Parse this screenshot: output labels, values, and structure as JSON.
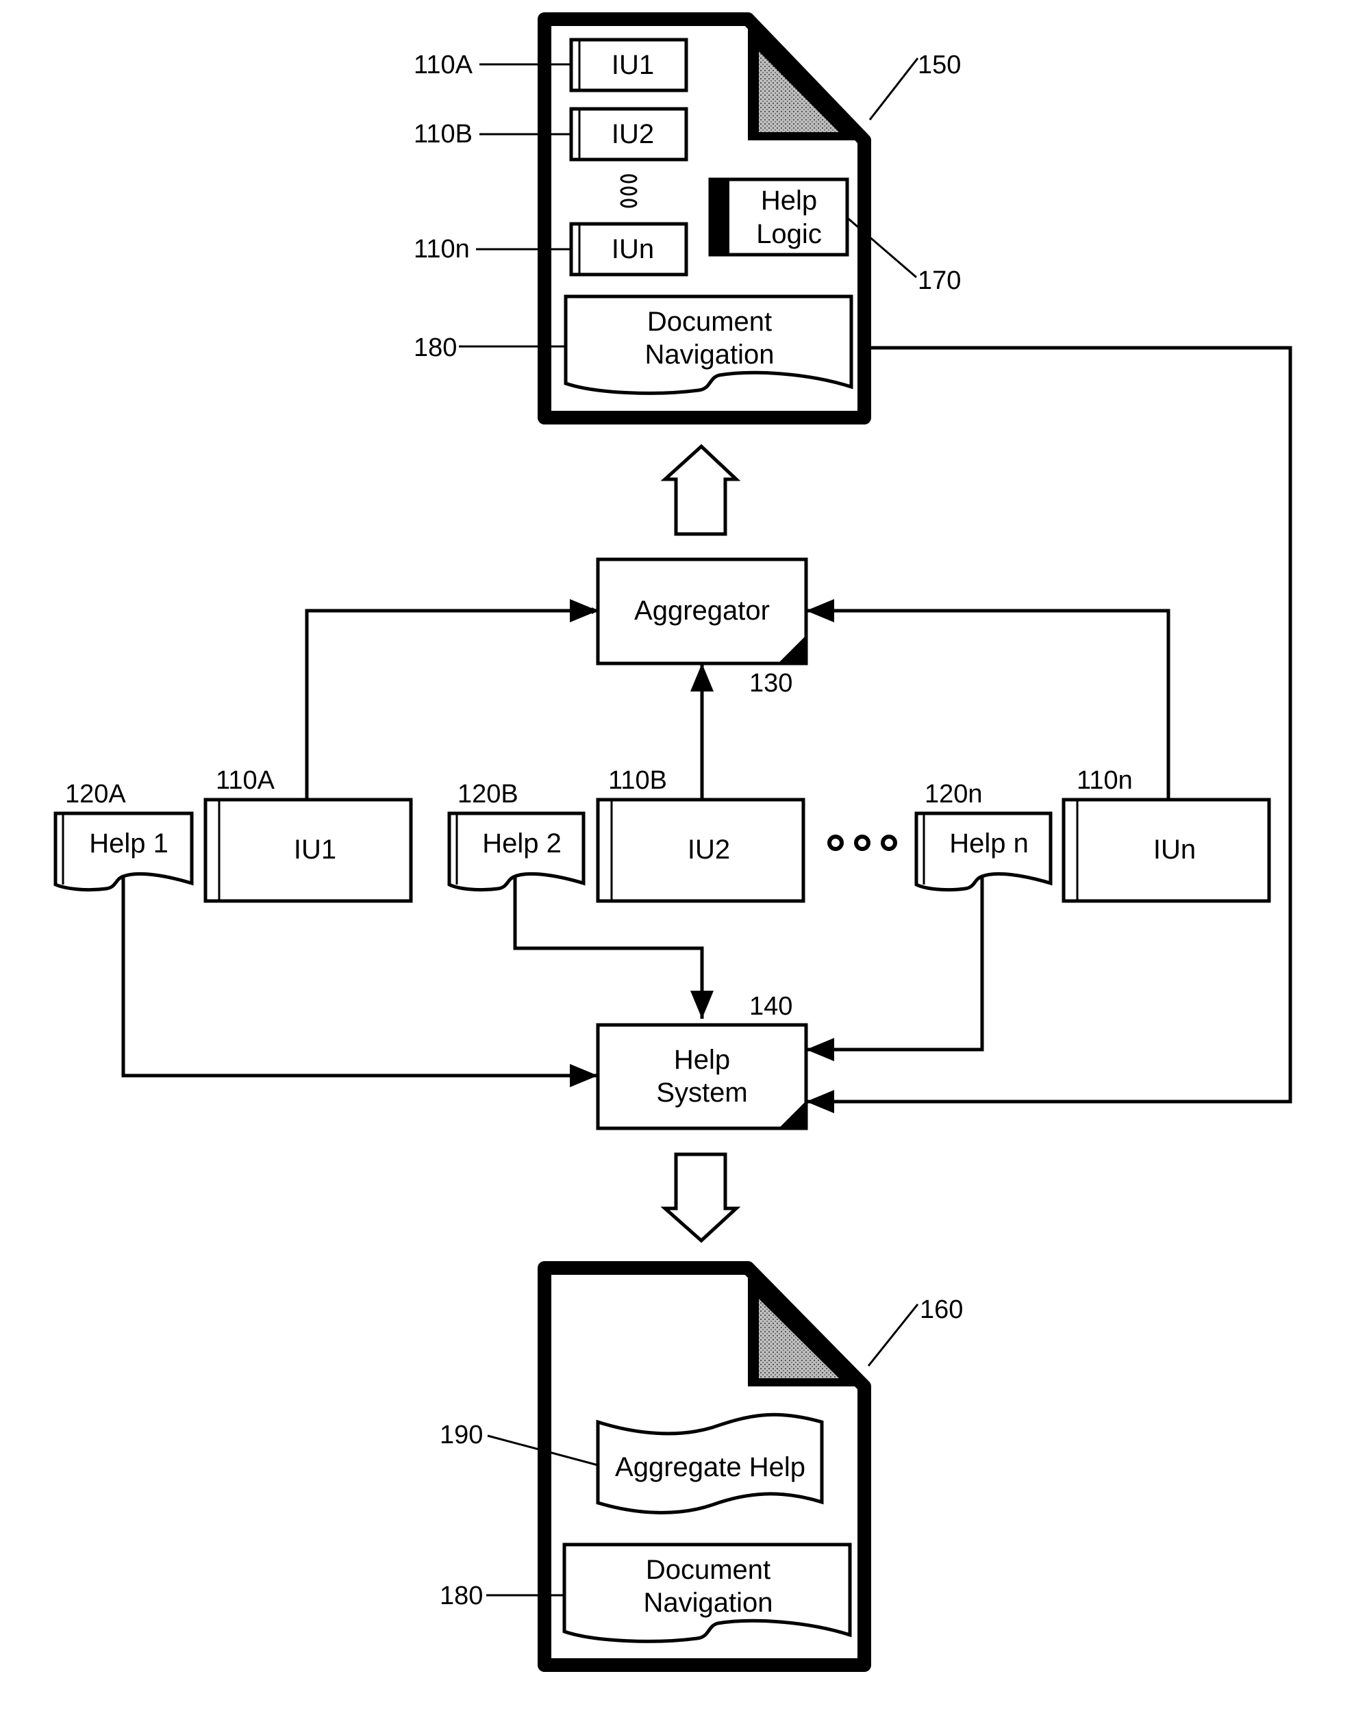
{
  "figure": {
    "doc_150": {
      "ref": "150",
      "units": [
        {
          "ref": "110A",
          "label": "IU1"
        },
        {
          "ref": "110B",
          "label": "IU2"
        },
        {
          "ref": "110n",
          "label": "IUn"
        }
      ],
      "help_logic": {
        "ref": "170",
        "line1": "Help",
        "line2": "Logic"
      },
      "navigation": {
        "ref": "180",
        "line1": "Document",
        "line2": "Navigation"
      }
    },
    "aggregator": {
      "ref": "130",
      "label": "Aggregator"
    },
    "help_system": {
      "ref": "140",
      "line1": "Help",
      "line2": "System"
    },
    "row": {
      "help_docs": [
        {
          "ref": "120A",
          "label": "Help 1"
        },
        {
          "ref": "120B",
          "label": "Help 2"
        },
        {
          "ref": "120n",
          "label": "Help n"
        }
      ],
      "units": [
        {
          "ref": "110A",
          "label": "IU1"
        },
        {
          "ref": "110B",
          "label": "IU2"
        },
        {
          "ref": "110n",
          "label": "IUn"
        }
      ]
    },
    "doc_160": {
      "ref": "160",
      "aggregate_help": {
        "ref": "190",
        "label": "Aggregate Help"
      },
      "navigation": {
        "ref": "180",
        "line1": "Document",
        "line2": "Navigation"
      }
    }
  }
}
